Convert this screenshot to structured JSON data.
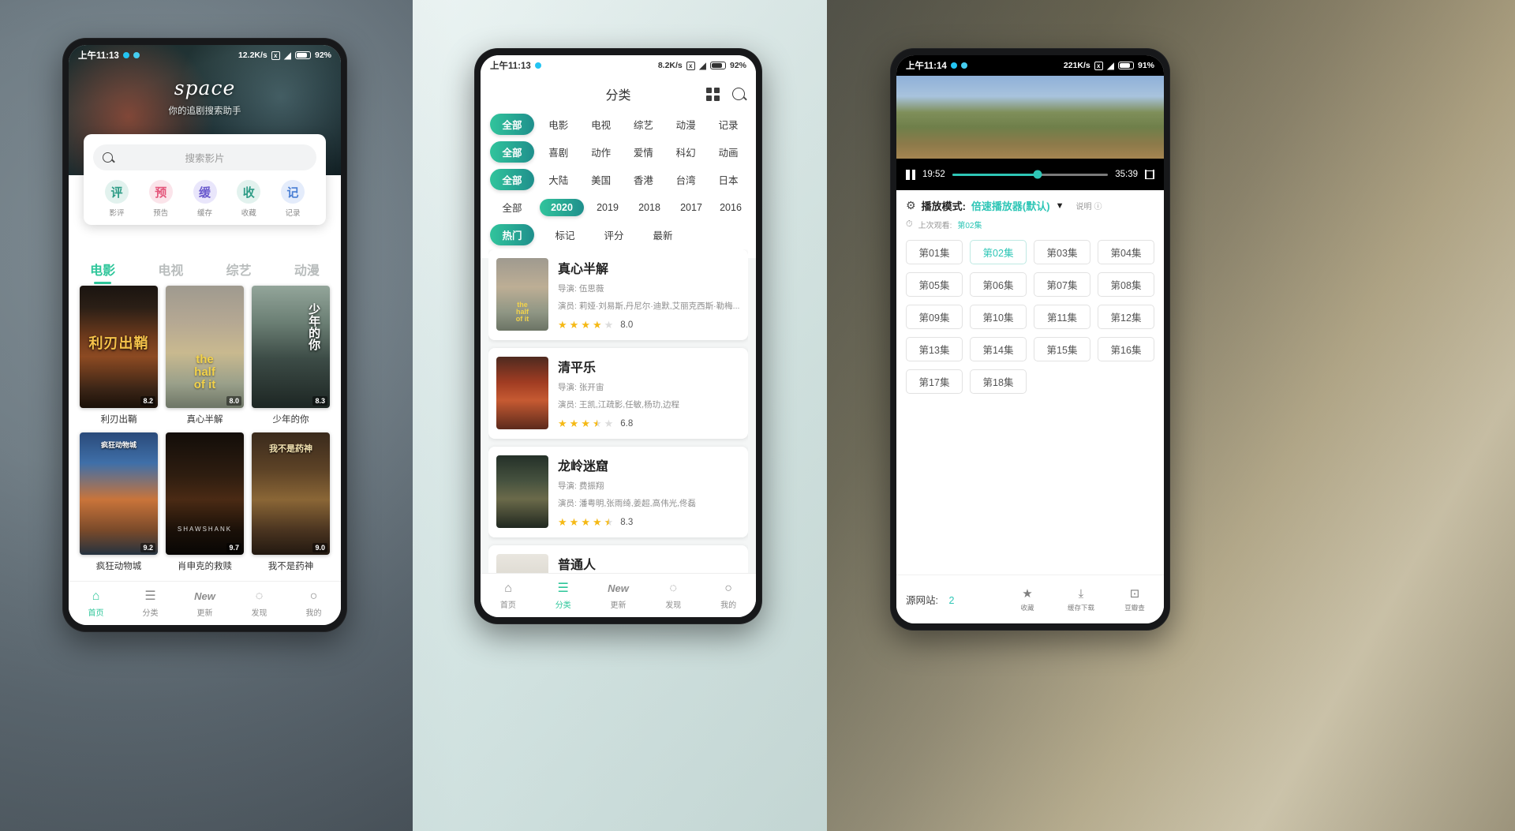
{
  "phone1": {
    "status": {
      "time": "上午11:13",
      "speed": "12.2K/s",
      "battery": "92%"
    },
    "hero": {
      "brand": "space",
      "subtitle": "你的追剧搜索助手"
    },
    "search": {
      "placeholder": "搜索影片",
      "icon": "search-icon"
    },
    "quick_actions": [
      {
        "glyph": "评",
        "label": "影评",
        "color": "#2e9c86",
        "bg": "#e2f2ee"
      },
      {
        "glyph": "预",
        "label": "预告",
        "color": "#e4557a",
        "bg": "#fbe4ea"
      },
      {
        "glyph": "缓",
        "label": "缓存",
        "color": "#6a5acd",
        "bg": "#e9e6fb"
      },
      {
        "glyph": "收",
        "label": "收藏",
        "color": "#2e9c86",
        "bg": "#e2f2ee"
      },
      {
        "glyph": "记",
        "label": "记录",
        "color": "#4a7fd4",
        "bg": "#e4ecfb"
      }
    ],
    "tabs": [
      {
        "label": "电影",
        "active": true
      },
      {
        "label": "电视",
        "active": false
      },
      {
        "label": "综艺",
        "active": false
      },
      {
        "label": "动漫",
        "active": false
      }
    ],
    "movies": [
      {
        "title": "利刃出鞘",
        "score": "8.2"
      },
      {
        "title": "真心半解",
        "score": "8.0"
      },
      {
        "title": "少年的你",
        "score": "8.3"
      },
      {
        "title": "疯狂动物城",
        "score": "9.2"
      },
      {
        "title": "肖申克的救赎",
        "score": "9.7"
      },
      {
        "title": "我不是药神",
        "score": "9.0"
      }
    ],
    "bottom_nav": [
      {
        "icon": "home-icon",
        "glyph": "⌂",
        "label": "首页",
        "active": true
      },
      {
        "icon": "category-icon",
        "glyph": "☰",
        "label": "分类",
        "active": false
      },
      {
        "icon": "new-icon",
        "glyph": "New",
        "label": "更新",
        "active": false
      },
      {
        "icon": "discover-icon",
        "glyph": "◌",
        "label": "发现",
        "active": false
      },
      {
        "icon": "profile-icon",
        "glyph": "○",
        "label": "我的",
        "active": false
      }
    ]
  },
  "phone2": {
    "status": {
      "time": "上午11:13",
      "speed": "8.2K/s",
      "battery": "92%"
    },
    "header": {
      "title": "分类",
      "grid_icon": "grid-view-icon",
      "search_icon": "search-icon"
    },
    "filter_rows": [
      {
        "chips": [
          {
            "label": "全部",
            "active": true
          },
          {
            "label": "电影",
            "active": false
          },
          {
            "label": "电视",
            "active": false
          },
          {
            "label": "综艺",
            "active": false
          },
          {
            "label": "动漫",
            "active": false
          },
          {
            "label": "记录",
            "active": false
          }
        ]
      },
      {
        "chips": [
          {
            "label": "全部",
            "active": true
          },
          {
            "label": "喜剧",
            "active": false
          },
          {
            "label": "动作",
            "active": false
          },
          {
            "label": "爱情",
            "active": false
          },
          {
            "label": "科幻",
            "active": false
          },
          {
            "label": "动画",
            "active": false
          }
        ]
      },
      {
        "chips": [
          {
            "label": "全部",
            "active": true
          },
          {
            "label": "大陆",
            "active": false
          },
          {
            "label": "美国",
            "active": false
          },
          {
            "label": "香港",
            "active": false
          },
          {
            "label": "台湾",
            "active": false
          },
          {
            "label": "日本",
            "active": false
          }
        ]
      },
      {
        "chips": [
          {
            "label": "全部",
            "active": false
          },
          {
            "label": "2020",
            "active": true
          },
          {
            "label": "2019",
            "active": false
          },
          {
            "label": "2018",
            "active": false
          },
          {
            "label": "2017",
            "active": false
          },
          {
            "label": "2016",
            "active": false
          }
        ]
      },
      {
        "chips": [
          {
            "label": "热门",
            "active": true
          },
          {
            "label": "标记",
            "active": false
          },
          {
            "label": "评分",
            "active": false
          },
          {
            "label": "最新",
            "active": false
          }
        ]
      }
    ],
    "list": [
      {
        "title": "真心半解",
        "director": "导演: 伍思薇",
        "cast": "演员: 莉娅·刘易斯,丹尼尔·迪默,艾丽克西斯·勒梅...",
        "score": "8.0",
        "stars_full": 4,
        "stars_half": 0
      },
      {
        "title": "清平乐",
        "director": "导演: 张开宙",
        "cast": "演员: 王凯,江疏影,任敏,杨玏,边程",
        "score": "6.8",
        "stars_full": 3,
        "stars_half": 1
      },
      {
        "title": "龙岭迷窟",
        "director": "导演: 费振翔",
        "cast": "演员: 潘粤明,张雨绮,姜超,高伟光,佟磊",
        "score": "8.3",
        "stars_full": 4,
        "stars_half": 1
      },
      {
        "title": "普通人",
        "director": "",
        "cast": "",
        "score": "",
        "stars_full": 0,
        "stars_half": 0
      }
    ],
    "bottom_nav": [
      {
        "icon": "home-icon",
        "glyph": "⌂",
        "label": "首页",
        "active": false
      },
      {
        "icon": "category-icon",
        "glyph": "☰",
        "label": "分类",
        "active": true
      },
      {
        "icon": "new-icon",
        "glyph": "New",
        "label": "更新",
        "active": false
      },
      {
        "icon": "discover-icon",
        "glyph": "◌",
        "label": "发现",
        "active": false
      },
      {
        "icon": "profile-icon",
        "glyph": "○",
        "label": "我的",
        "active": false
      }
    ]
  },
  "phone3": {
    "status": {
      "time": "上午11:14",
      "speed": "221K/s",
      "battery": "91%"
    },
    "player": {
      "pause_icon": "pause-icon",
      "current_time": "19:52",
      "total_time": "35:39",
      "progress_percent": 55,
      "fullscreen_icon": "fullscreen-icon"
    },
    "mode": {
      "gear_icon": "gear-icon",
      "label": "播放模式:",
      "value": "倍速播放器(默认)",
      "caret": "▼",
      "help": "说明",
      "help_icon": "info-icon"
    },
    "last_watch": {
      "clock_icon": "clock-icon",
      "label": "上次观看:",
      "value": "第02集"
    },
    "episodes": [
      {
        "label": "第01集",
        "active": false
      },
      {
        "label": "第02集",
        "active": true
      },
      {
        "label": "第03集",
        "active": false
      },
      {
        "label": "第04集",
        "active": false
      },
      {
        "label": "第05集",
        "active": false
      },
      {
        "label": "第06集",
        "active": false
      },
      {
        "label": "第07集",
        "active": false
      },
      {
        "label": "第08集",
        "active": false
      },
      {
        "label": "第09集",
        "active": false
      },
      {
        "label": "第10集",
        "active": false
      },
      {
        "label": "第11集",
        "active": false
      },
      {
        "label": "第12集",
        "active": false
      },
      {
        "label": "第13集",
        "active": false
      },
      {
        "label": "第14集",
        "active": false
      },
      {
        "label": "第15集",
        "active": false
      },
      {
        "label": "第16集",
        "active": false
      },
      {
        "label": "第17集",
        "active": false
      },
      {
        "label": "第18集",
        "active": false
      }
    ],
    "bottom": {
      "source_label": "源网站:",
      "source_count": "2",
      "actions": [
        {
          "icon": "star-icon",
          "glyph": "★",
          "label": "收藏"
        },
        {
          "icon": "download-icon",
          "glyph": "⤓",
          "label": "缓存下载"
        },
        {
          "icon": "douban-icon",
          "glyph": "⊡",
          "label": "豆瓣查"
        }
      ]
    }
  },
  "theme": {
    "accent": "#2ec6b6",
    "accent_green": "#2ec69a",
    "star": "#f5b915"
  }
}
